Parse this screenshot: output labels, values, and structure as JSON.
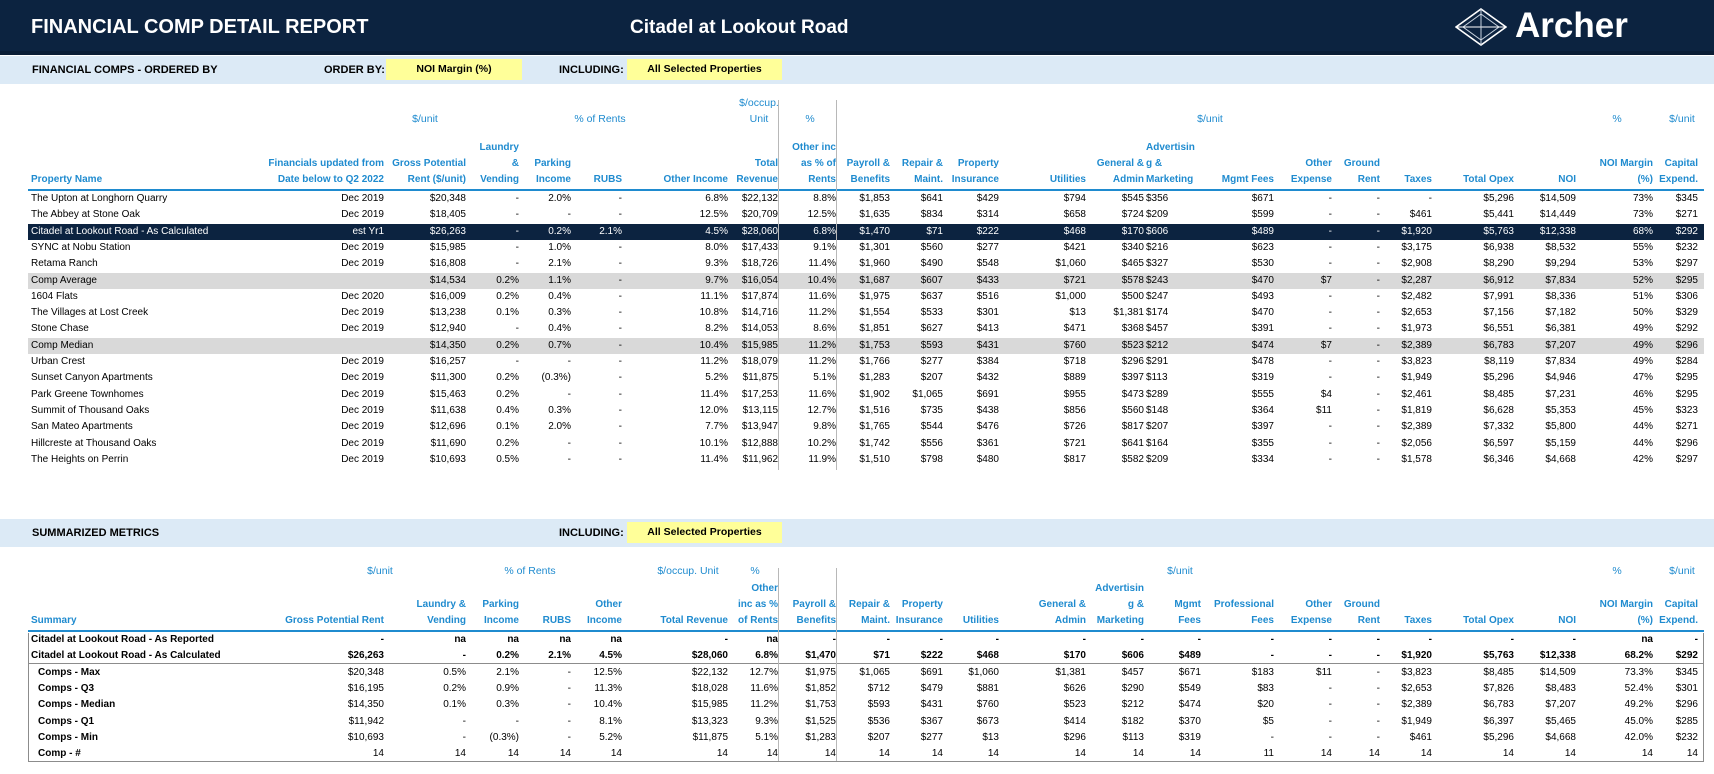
{
  "header": {
    "report_title": "FINANCIAL COMP DETAIL REPORT",
    "property_title": "Citadel at Lookout Road",
    "logo_text": "Archer",
    "logo_icon": "archer-logo-icon",
    "colors": {
      "navy": "#0c2340",
      "accent_blue": "#1f8bcf",
      "section_bg": "#dceaf6",
      "filter_yellow": "#ffff99",
      "row_shade": "#d9d9d9"
    }
  },
  "comps_section": {
    "title": "FINANCIAL COMPS - ORDERED BY",
    "order_by_label": "ORDER BY:",
    "order_by_value": "NOI Margin (%)",
    "including_label": "INCLUDING:",
    "including_value": "All Selected Properties"
  },
  "summary_section": {
    "title": "SUMMARIZED  METRICS",
    "including_label": "INCLUDING:",
    "including_value": "All Selected Properties"
  },
  "comp_table": {
    "group_headers": [
      {
        "text": "$/unit"
      },
      {
        "text": "% of Rents"
      },
      {
        "text": "$/occup."
      },
      {
        "text": "Unit"
      },
      {
        "text": "%"
      },
      {
        "text": "$/unit"
      },
      {
        "text": "%"
      },
      {
        "text": "$/unit"
      }
    ],
    "columns": [
      {
        "lines": [
          "Property Name"
        ]
      },
      {
        "lines": [
          "Financials updated from",
          "Date below to Q2 2022"
        ]
      },
      {
        "lines": [
          "Gross Potential",
          "Rent ($/unit)"
        ]
      },
      {
        "lines": [
          "Laundry",
          "&",
          "Vending"
        ]
      },
      {
        "lines": [
          "Parking",
          "Income"
        ]
      },
      {
        "lines": [
          "RUBS"
        ]
      },
      {
        "lines": [
          "Other Income"
        ]
      },
      {
        "lines": [
          "Total",
          "Revenue"
        ]
      },
      {
        "lines": [
          "Other inc",
          "as % of",
          "Rents"
        ]
      },
      {
        "lines": [
          "Payroll &",
          "Benefits"
        ]
      },
      {
        "lines": [
          "Repair &",
          "Maint."
        ]
      },
      {
        "lines": [
          "Property",
          "Insurance"
        ]
      },
      {
        "lines": [
          "Utilities"
        ]
      },
      {
        "lines": [
          "General &",
          "Admin"
        ]
      },
      {
        "lines": [
          "Advertisin",
          "g &",
          "Marketing"
        ]
      },
      {
        "lines": [
          "Mgmt Fees"
        ]
      },
      {
        "lines": [
          "Other",
          "Expense"
        ]
      },
      {
        "lines": [
          "Ground",
          "Rent"
        ]
      },
      {
        "lines": [
          "Taxes"
        ]
      },
      {
        "lines": [
          "Total Opex"
        ]
      },
      {
        "lines": [
          "NOI"
        ]
      },
      {
        "lines": [
          "NOI Margin",
          "(%)"
        ]
      },
      {
        "lines": [
          "Capital",
          "Expend."
        ]
      }
    ],
    "rows": [
      {
        "style": "",
        "cells": [
          "The Upton at Longhorn Quarry",
          "Dec 2019",
          "$20,348",
          "-",
          "2.0%",
          "-",
          "6.8%",
          "$22,132",
          "8.8%",
          "$1,853",
          "$641",
          "$429",
          "$794",
          "$545",
          "$356",
          "$671",
          "-",
          "-",
          "-",
          "$5,296",
          "$14,509",
          "73%",
          "$345"
        ]
      },
      {
        "style": "",
        "cells": [
          "The Abbey at Stone Oak",
          "Dec 2019",
          "$18,405",
          "-",
          "-",
          "-",
          "12.5%",
          "$20,709",
          "12.5%",
          "$1,635",
          "$834",
          "$314",
          "$658",
          "$724",
          "$209",
          "$599",
          "-",
          "-",
          "$461",
          "$5,441",
          "$14,449",
          "73%",
          "$271"
        ]
      },
      {
        "style": "highlight",
        "cells": [
          "Citadel at Lookout Road - As Calculated",
          "est Yr1",
          "$26,263",
          "-",
          "0.2%",
          "2.1%",
          "4.5%",
          "$28,060",
          "6.8%",
          "$1,470",
          "$71",
          "$222",
          "$468",
          "$170",
          "$606",
          "$489",
          "-",
          "-",
          "$1,920",
          "$5,763",
          "$12,338",
          "68%",
          "$292"
        ]
      },
      {
        "style": "",
        "cells": [
          "SYNC at Nobu Station",
          "Dec 2019",
          "$15,985",
          "-",
          "1.0%",
          "-",
          "8.0%",
          "$17,433",
          "9.1%",
          "$1,301",
          "$560",
          "$277",
          "$421",
          "$340",
          "$216",
          "$623",
          "-",
          "-",
          "$3,175",
          "$6,938",
          "$8,532",
          "55%",
          "$232"
        ]
      },
      {
        "style": "",
        "cells": [
          "Retama Ranch",
          "Dec 2019",
          "$16,808",
          "-",
          "2.1%",
          "-",
          "9.3%",
          "$18,726",
          "11.4%",
          "$1,960",
          "$490",
          "$548",
          "$1,060",
          "$465",
          "$327",
          "$530",
          "-",
          "-",
          "$2,908",
          "$8,290",
          "$9,294",
          "53%",
          "$297"
        ]
      },
      {
        "style": "shade",
        "cells": [
          "Comp Average",
          "",
          "$14,534",
          "0.2%",
          "1.1%",
          "-",
          "9.7%",
          "$16,054",
          "10.4%",
          "$1,687",
          "$607",
          "$433",
          "$721",
          "$578",
          "$243",
          "$470",
          "$7",
          "-",
          "$2,287",
          "$6,912",
          "$7,834",
          "52%",
          "$295"
        ]
      },
      {
        "style": "",
        "cells": [
          "1604 Flats",
          "Dec 2020",
          "$16,009",
          "0.2%",
          "0.4%",
          "-",
          "11.1%",
          "$17,874",
          "11.6%",
          "$1,975",
          "$637",
          "$516",
          "$1,000",
          "$500",
          "$247",
          "$493",
          "-",
          "-",
          "$2,482",
          "$7,991",
          "$8,336",
          "51%",
          "$306"
        ]
      },
      {
        "style": "",
        "cells": [
          "The Villages at Lost Creek",
          "Dec 2019",
          "$13,238",
          "0.1%",
          "0.3%",
          "-",
          "10.8%",
          "$14,716",
          "11.2%",
          "$1,554",
          "$533",
          "$301",
          "$13",
          "$1,381",
          "$174",
          "$470",
          "-",
          "-",
          "$2,653",
          "$7,156",
          "$7,182",
          "50%",
          "$329"
        ]
      },
      {
        "style": "",
        "cells": [
          "Stone Chase",
          "Dec 2019",
          "$12,940",
          "-",
          "0.4%",
          "-",
          "8.2%",
          "$14,053",
          "8.6%",
          "$1,851",
          "$627",
          "$413",
          "$471",
          "$368",
          "$457",
          "$391",
          "-",
          "-",
          "$1,973",
          "$6,551",
          "$6,381",
          "49%",
          "$292"
        ]
      },
      {
        "style": "shade",
        "cells": [
          "Comp Median",
          "",
          "$14,350",
          "0.2%",
          "0.7%",
          "-",
          "10.4%",
          "$15,985",
          "11.2%",
          "$1,753",
          "$593",
          "$431",
          "$760",
          "$523",
          "$212",
          "$474",
          "$7",
          "-",
          "$2,389",
          "$6,783",
          "$7,207",
          "49%",
          "$296"
        ]
      },
      {
        "style": "",
        "cells": [
          "Urban Crest",
          "Dec 2019",
          "$16,257",
          "-",
          "-",
          "-",
          "11.2%",
          "$18,079",
          "11.2%",
          "$1,766",
          "$277",
          "$384",
          "$718",
          "$296",
          "$291",
          "$478",
          "-",
          "-",
          "$3,823",
          "$8,119",
          "$7,834",
          "49%",
          "$284"
        ]
      },
      {
        "style": "",
        "cells": [
          "Sunset Canyon Apartments",
          "Dec 2019",
          "$11,300",
          "0.2%",
          "(0.3%)",
          "-",
          "5.2%",
          "$11,875",
          "5.1%",
          "$1,283",
          "$207",
          "$432",
          "$889",
          "$397",
          "$113",
          "$319",
          "-",
          "-",
          "$1,949",
          "$5,296",
          "$4,946",
          "47%",
          "$295"
        ]
      },
      {
        "style": "",
        "cells": [
          "Park Greene Townhomes",
          "Dec 2019",
          "$15,463",
          "0.2%",
          "-",
          "-",
          "11.4%",
          "$17,253",
          "11.6%",
          "$1,902",
          "$1,065",
          "$691",
          "$955",
          "$473",
          "$289",
          "$555",
          "$4",
          "-",
          "$2,461",
          "$8,485",
          "$7,231",
          "46%",
          "$295"
        ]
      },
      {
        "style": "",
        "cells": [
          "Summit of Thousand Oaks",
          "Dec 2019",
          "$11,638",
          "0.4%",
          "0.3%",
          "-",
          "12.0%",
          "$13,115",
          "12.7%",
          "$1,516",
          "$735",
          "$438",
          "$856",
          "$560",
          "$148",
          "$364",
          "$11",
          "-",
          "$1,819",
          "$6,628",
          "$5,353",
          "45%",
          "$323"
        ]
      },
      {
        "style": "",
        "cells": [
          "San Mateo Apartments",
          "Dec 2019",
          "$12,696",
          "0.1%",
          "2.0%",
          "-",
          "7.7%",
          "$13,947",
          "9.8%",
          "$1,765",
          "$544",
          "$476",
          "$726",
          "$817",
          "$207",
          "$397",
          "-",
          "-",
          "$2,389",
          "$7,332",
          "$5,800",
          "44%",
          "$271"
        ]
      },
      {
        "style": "",
        "cells": [
          "Hillcreste at Thousand Oaks",
          "Dec 2019",
          "$11,690",
          "0.2%",
          "-",
          "-",
          "10.1%",
          "$12,888",
          "10.2%",
          "$1,742",
          "$556",
          "$361",
          "$721",
          "$641",
          "$164",
          "$355",
          "-",
          "-",
          "$2,056",
          "$6,597",
          "$5,159",
          "44%",
          "$296"
        ]
      },
      {
        "style": "",
        "cells": [
          "The Heights on Perrin",
          "Dec 2019",
          "$10,693",
          "0.5%",
          "-",
          "-",
          "11.4%",
          "$11,962",
          "11.9%",
          "$1,510",
          "$798",
          "$480",
          "$817",
          "$582",
          "$209",
          "$334",
          "-",
          "-",
          "$1,578",
          "$6,346",
          "$4,668",
          "42%",
          "$297"
        ]
      }
    ]
  },
  "summary_table": {
    "group_headers": [
      {
        "text": "$/unit"
      },
      {
        "text": "% of Rents"
      },
      {
        "text": "$/occup. Unit"
      },
      {
        "text": "%"
      },
      {
        "text": "$/unit"
      },
      {
        "text": "%"
      },
      {
        "text": "$/unit"
      }
    ],
    "columns": [
      {
        "lines": [
          "Summary"
        ]
      },
      {
        "lines": [
          "Gross Potential Rent"
        ]
      },
      {
        "lines": [
          "Laundry &",
          "Vending"
        ]
      },
      {
        "lines": [
          "Parking",
          "Income"
        ]
      },
      {
        "lines": [
          "RUBS"
        ]
      },
      {
        "lines": [
          "Other",
          "Income"
        ]
      },
      {
        "lines": [
          "Total Revenue"
        ]
      },
      {
        "lines": [
          "Other",
          "inc as %",
          "of Rents"
        ]
      },
      {
        "lines": [
          "Payroll &",
          "Benefits"
        ]
      },
      {
        "lines": [
          "Repair &",
          "Maint."
        ]
      },
      {
        "lines": [
          "Property",
          "Insurance"
        ]
      },
      {
        "lines": [
          "Utilities"
        ]
      },
      {
        "lines": [
          "General &",
          "Admin"
        ]
      },
      {
        "lines": [
          "Advertisin",
          "g &",
          "Marketing"
        ]
      },
      {
        "lines": [
          "Mgmt",
          "Fees"
        ]
      },
      {
        "lines": [
          "Professional",
          "Fees"
        ]
      },
      {
        "lines": [
          "Other",
          "Expense"
        ]
      },
      {
        "lines": [
          "Ground",
          "Rent"
        ]
      },
      {
        "lines": [
          "Taxes"
        ]
      },
      {
        "lines": [
          "Total Opex"
        ]
      },
      {
        "lines": [
          "NOI"
        ]
      },
      {
        "lines": [
          "NOI Margin",
          "(%)"
        ]
      },
      {
        "lines": [
          "Capital",
          "Expend."
        ]
      }
    ],
    "rows": [
      {
        "style": "bold-row",
        "cells": [
          "Citadel at Lookout Road - As Reported",
          "-",
          "na",
          "na",
          "na",
          "na",
          "-",
          "na",
          "-",
          "-",
          "-",
          "-",
          "-",
          "-",
          "-",
          "-",
          "-",
          "-",
          "-",
          "-",
          "-",
          "na",
          "-"
        ]
      },
      {
        "style": "bold-row sep",
        "cells": [
          "Citadel at Lookout Road - As Calculated",
          "$26,263",
          "-",
          "0.2%",
          "2.1%",
          "4.5%",
          "$28,060",
          "6.8%",
          "$1,470",
          "$71",
          "$222",
          "$468",
          "$170",
          "$606",
          "$489",
          "-",
          "-",
          "-",
          "$1,920",
          "$5,763",
          "$12,338",
          "68.2%",
          "$292"
        ]
      },
      {
        "style": "indent",
        "cells": [
          "Comps - Max",
          "$20,348",
          "0.5%",
          "2.1%",
          "-",
          "12.5%",
          "$22,132",
          "12.7%",
          "$1,975",
          "$1,065",
          "$691",
          "$1,060",
          "$1,381",
          "$457",
          "$671",
          "$183",
          "$11",
          "-",
          "$3,823",
          "$8,485",
          "$14,509",
          "73.3%",
          "$345"
        ]
      },
      {
        "style": "indent",
        "cells": [
          "Comps - Q3",
          "$16,195",
          "0.2%",
          "0.9%",
          "-",
          "11.3%",
          "$18,028",
          "11.6%",
          "$1,852",
          "$712",
          "$479",
          "$881",
          "$626",
          "$290",
          "$549",
          "$83",
          "-",
          "-",
          "$2,653",
          "$7,826",
          "$8,483",
          "52.4%",
          "$301"
        ]
      },
      {
        "style": "indent",
        "cells": [
          "Comps - Median",
          "$14,350",
          "0.1%",
          "0.3%",
          "-",
          "10.4%",
          "$15,985",
          "11.2%",
          "$1,753",
          "$593",
          "$431",
          "$760",
          "$523",
          "$212",
          "$474",
          "$20",
          "-",
          "-",
          "$2,389",
          "$6,783",
          "$7,207",
          "49.2%",
          "$296"
        ]
      },
      {
        "style": "indent",
        "cells": [
          "Comps - Q1",
          "$11,942",
          "-",
          "-",
          "-",
          "8.1%",
          "$13,323",
          "9.3%",
          "$1,525",
          "$536",
          "$367",
          "$673",
          "$414",
          "$182",
          "$370",
          "$5",
          "-",
          "-",
          "$1,949",
          "$6,397",
          "$5,465",
          "45.0%",
          "$285"
        ]
      },
      {
        "style": "indent",
        "cells": [
          "Comps - Min",
          "$10,693",
          "-",
          "(0.3%)",
          "-",
          "5.2%",
          "$11,875",
          "5.1%",
          "$1,283",
          "$207",
          "$277",
          "$13",
          "$296",
          "$113",
          "$319",
          "-",
          "-",
          "-",
          "$461",
          "$5,296",
          "$4,668",
          "42.0%",
          "$232"
        ]
      },
      {
        "style": "indent",
        "cells": [
          "Comp - #",
          "14",
          "14",
          "14",
          "14",
          "14",
          "14",
          "14",
          "14",
          "14",
          "14",
          "14",
          "14",
          "14",
          "14",
          "11",
          "14",
          "14",
          "14",
          "14",
          "14",
          "14",
          "14"
        ]
      }
    ]
  }
}
